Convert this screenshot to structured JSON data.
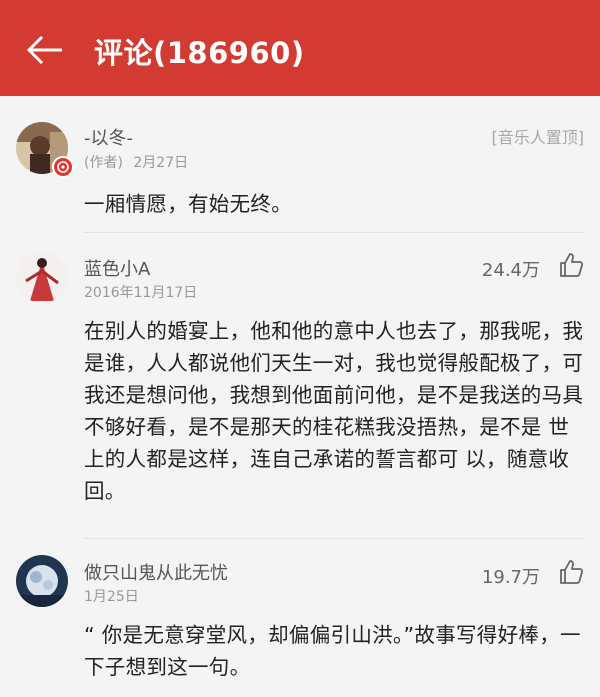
{
  "header": {
    "title": "评论(186960)",
    "back_icon": "arrow-left-icon"
  },
  "colors": {
    "brand": "#d33a31",
    "badge": "#e0392e"
  },
  "comments": [
    {
      "name": "-以冬-",
      "role": "(作者)",
      "date": "2月27日",
      "pin": "[音乐人置顶]",
      "likes": "",
      "text": "一厢情愿，有始无终。"
    },
    {
      "name": "蓝色小A",
      "role": "",
      "date": "2016年11月17日",
      "pin": "",
      "likes": "24.4万",
      "text": "在别人的婚宴上，他和他的意中人也去了，那我呢，我是谁，人人都说他们天生一对，我也觉得般配极了，可我还是想问他，我想到他面前问他，是不是我送的马具不够好看，是不是那天的桂花糕我没捂热，是不是 世上的人都是这样，连自己承诺的誓言都可 以，随意收回。"
    },
    {
      "name": "做只山鬼从此无忧",
      "role": "",
      "date": "1月25日",
      "pin": "",
      "likes": "19.7万",
      "text": "“ 你是无意穿堂风，却偏偏引山洪。”故事写得好棒，一下子想到这一句。"
    }
  ]
}
